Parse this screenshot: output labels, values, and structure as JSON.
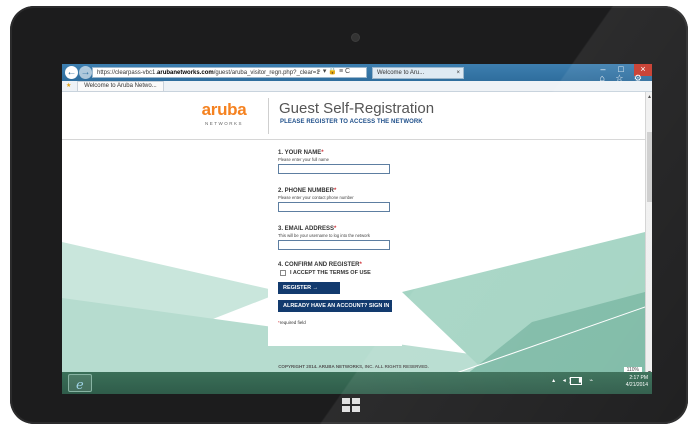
{
  "browser": {
    "url_prefix": "https://clearpass-vbc1.",
    "url_domain": "arubanetworks.com",
    "url_path": "/guest/aruba_visitor_regn.php?_clear=1",
    "tab_label": "Welcome to Aru...",
    "tab_close": "×",
    "favorites_tab": "Welcome to Aruba Netwo...",
    "nav_back": "←",
    "nav_forward": "→",
    "address_icons": "⌕ ▾ 🔒 ≡ C",
    "window_minimize": "–",
    "window_restore": "□",
    "window_close": "×",
    "tools_icons": "⌂ ☆ ⚙",
    "zoom": "110%"
  },
  "header": {
    "logo_wordmark": "aruba",
    "logo_sub": "NETWORKS",
    "title": "Guest Self-Registration",
    "subtitle": "PLEASE REGISTER TO ACCESS THE NETWORK"
  },
  "form": {
    "name": {
      "label": "1. YOUR NAME",
      "hint": "Please enter your full name",
      "value": ""
    },
    "phone": {
      "label": "2. PHONE NUMBER",
      "hint": "Please enter your contact phone number",
      "value": ""
    },
    "email": {
      "label": "3. EMAIL ADDRESS",
      "hint": "This will be your username to log into the network",
      "value": ""
    },
    "confirm": {
      "label": "4. CONFIRM AND REGISTER",
      "terms_label": "I ACCEPT THE TERMS OF USE",
      "terms_checked": false
    },
    "required_marker": "*",
    "register_button": "REGISTER  →",
    "signin_prefix": "ALREADY HAVE AN ACCOUNT?",
    "signin_strong": "SIGN IN",
    "signin_arrow": "→",
    "required_note": "required field"
  },
  "footer": {
    "copyright": "COPYRIGHT 2014. ARUBA NETWORKS, INC. ALL RIGHTS RESERVED."
  },
  "taskbar": {
    "tray_icons": "▴ ◂) ▮ ⌁",
    "time": "2:17 PM",
    "date": "4/21/2014"
  },
  "colors": {
    "brand_orange": "#f58220",
    "brand_navy": "#123a6e",
    "teal_light": "#b9ddd2",
    "teal_mid": "#8fc8b6",
    "taskbar": "#2f5c4a"
  }
}
